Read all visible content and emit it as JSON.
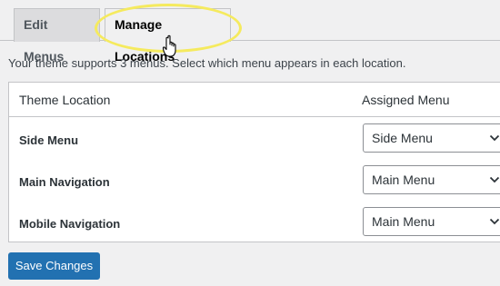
{
  "tabs": [
    {
      "label": "Edit Menus",
      "active": false
    },
    {
      "label": "Manage Locations",
      "active": true
    }
  ],
  "description": "Your theme supports 3 menus. Select which menu appears in each location.",
  "table": {
    "headers": {
      "location": "Theme Location",
      "menu": "Assigned Menu"
    },
    "rows": [
      {
        "location": "Side Menu",
        "menu": "Side Menu"
      },
      {
        "location": "Main Navigation",
        "menu": "Main Menu"
      },
      {
        "location": "Mobile Navigation",
        "menu": "Main Menu"
      }
    ]
  },
  "save_button": "Save Changes",
  "colors": {
    "primary": "#2271b1",
    "highlight": "#f5ea5e",
    "background": "#f0f0f1"
  },
  "icons": {
    "cursor": "hand-pointer-icon",
    "dropdown": "chevron-down-icon"
  }
}
